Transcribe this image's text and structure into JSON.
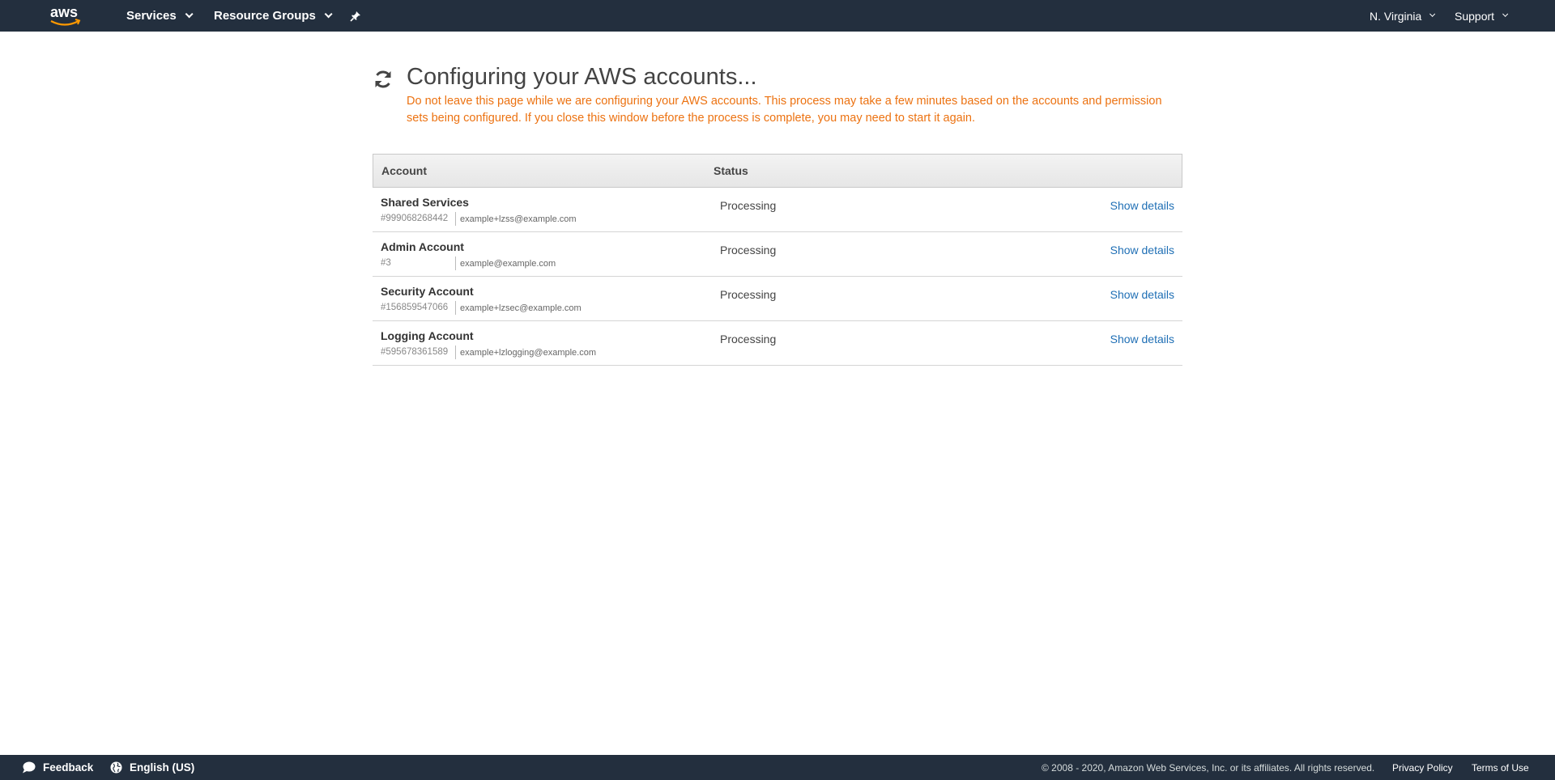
{
  "nav": {
    "logo_text": "aws",
    "services": "Services",
    "resource_groups": "Resource Groups",
    "region": "N. Virginia",
    "support": "Support"
  },
  "header": {
    "title": "Configuring your AWS accounts...",
    "warning": "Do not leave this page while we are configuring your AWS accounts. This process may take a few minutes based on the accounts and permission sets being configured. If you close this window before the process is complete, you may need to start it again."
  },
  "table": {
    "headers": {
      "account": "Account",
      "status": "Status"
    },
    "rows": [
      {
        "name": "Shared Services",
        "id": "#999068268442",
        "email": "example+lzss@example.com",
        "status": "Processing",
        "action": "Show details"
      },
      {
        "name": "Admin Account",
        "id": "#3",
        "email": "example@example.com",
        "status": "Processing",
        "action": "Show details"
      },
      {
        "name": "Security Account",
        "id": "#156859547066",
        "email": "example+lzsec@example.com",
        "status": "Processing",
        "action": "Show details"
      },
      {
        "name": "Logging Account",
        "id": "#595678361589",
        "email": "example+lzlogging@example.com",
        "status": "Processing",
        "action": "Show details"
      }
    ]
  },
  "footer": {
    "feedback": "Feedback",
    "language": "English (US)",
    "copyright": "© 2008 - 2020, Amazon Web Services, Inc. or its affiliates. All rights reserved.",
    "privacy": "Privacy Policy",
    "terms": "Terms of Use"
  },
  "colors": {
    "nav_bg": "#232f3e",
    "warning": "#ec7211",
    "link": "#1f6fb5",
    "aws_smile": "#ff9900"
  },
  "icons": {
    "logo": "aws-logo-icon",
    "pin": "pin-icon",
    "refresh": "refresh-icon",
    "feedback": "speech-bubble-icon",
    "language": "globe-icon"
  }
}
